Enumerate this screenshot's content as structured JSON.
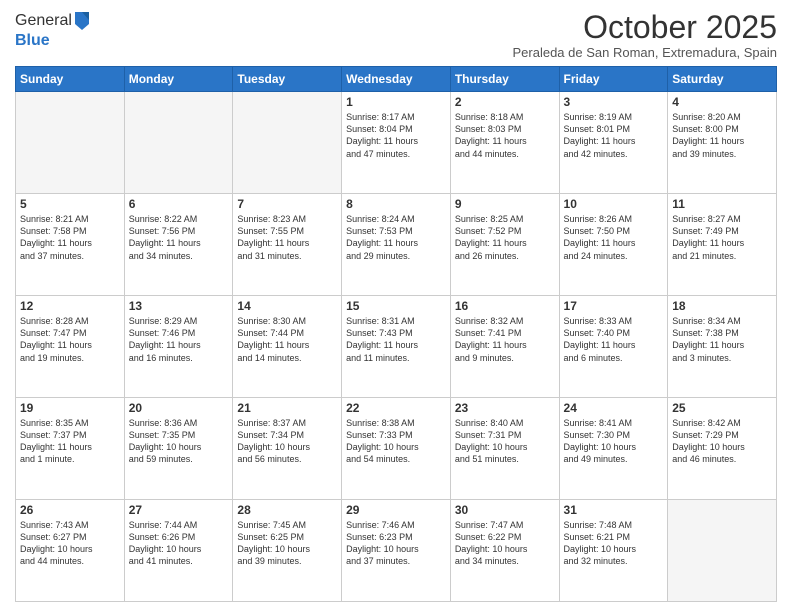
{
  "logo": {
    "general": "General",
    "blue": "Blue"
  },
  "header": {
    "month": "October 2025",
    "location": "Peraleda de San Roman, Extremadura, Spain"
  },
  "days": [
    "Sunday",
    "Monday",
    "Tuesday",
    "Wednesday",
    "Thursday",
    "Friday",
    "Saturday"
  ],
  "weeks": [
    [
      {
        "day": "",
        "content": ""
      },
      {
        "day": "",
        "content": ""
      },
      {
        "day": "",
        "content": ""
      },
      {
        "day": "1",
        "content": "Sunrise: 8:17 AM\nSunset: 8:04 PM\nDaylight: 11 hours\nand 47 minutes."
      },
      {
        "day": "2",
        "content": "Sunrise: 8:18 AM\nSunset: 8:03 PM\nDaylight: 11 hours\nand 44 minutes."
      },
      {
        "day": "3",
        "content": "Sunrise: 8:19 AM\nSunset: 8:01 PM\nDaylight: 11 hours\nand 42 minutes."
      },
      {
        "day": "4",
        "content": "Sunrise: 8:20 AM\nSunset: 8:00 PM\nDaylight: 11 hours\nand 39 minutes."
      }
    ],
    [
      {
        "day": "5",
        "content": "Sunrise: 8:21 AM\nSunset: 7:58 PM\nDaylight: 11 hours\nand 37 minutes."
      },
      {
        "day": "6",
        "content": "Sunrise: 8:22 AM\nSunset: 7:56 PM\nDaylight: 11 hours\nand 34 minutes."
      },
      {
        "day": "7",
        "content": "Sunrise: 8:23 AM\nSunset: 7:55 PM\nDaylight: 11 hours\nand 31 minutes."
      },
      {
        "day": "8",
        "content": "Sunrise: 8:24 AM\nSunset: 7:53 PM\nDaylight: 11 hours\nand 29 minutes."
      },
      {
        "day": "9",
        "content": "Sunrise: 8:25 AM\nSunset: 7:52 PM\nDaylight: 11 hours\nand 26 minutes."
      },
      {
        "day": "10",
        "content": "Sunrise: 8:26 AM\nSunset: 7:50 PM\nDaylight: 11 hours\nand 24 minutes."
      },
      {
        "day": "11",
        "content": "Sunrise: 8:27 AM\nSunset: 7:49 PM\nDaylight: 11 hours\nand 21 minutes."
      }
    ],
    [
      {
        "day": "12",
        "content": "Sunrise: 8:28 AM\nSunset: 7:47 PM\nDaylight: 11 hours\nand 19 minutes."
      },
      {
        "day": "13",
        "content": "Sunrise: 8:29 AM\nSunset: 7:46 PM\nDaylight: 11 hours\nand 16 minutes."
      },
      {
        "day": "14",
        "content": "Sunrise: 8:30 AM\nSunset: 7:44 PM\nDaylight: 11 hours\nand 14 minutes."
      },
      {
        "day": "15",
        "content": "Sunrise: 8:31 AM\nSunset: 7:43 PM\nDaylight: 11 hours\nand 11 minutes."
      },
      {
        "day": "16",
        "content": "Sunrise: 8:32 AM\nSunset: 7:41 PM\nDaylight: 11 hours\nand 9 minutes."
      },
      {
        "day": "17",
        "content": "Sunrise: 8:33 AM\nSunset: 7:40 PM\nDaylight: 11 hours\nand 6 minutes."
      },
      {
        "day": "18",
        "content": "Sunrise: 8:34 AM\nSunset: 7:38 PM\nDaylight: 11 hours\nand 3 minutes."
      }
    ],
    [
      {
        "day": "19",
        "content": "Sunrise: 8:35 AM\nSunset: 7:37 PM\nDaylight: 11 hours\nand 1 minute."
      },
      {
        "day": "20",
        "content": "Sunrise: 8:36 AM\nSunset: 7:35 PM\nDaylight: 10 hours\nand 59 minutes."
      },
      {
        "day": "21",
        "content": "Sunrise: 8:37 AM\nSunset: 7:34 PM\nDaylight: 10 hours\nand 56 minutes."
      },
      {
        "day": "22",
        "content": "Sunrise: 8:38 AM\nSunset: 7:33 PM\nDaylight: 10 hours\nand 54 minutes."
      },
      {
        "day": "23",
        "content": "Sunrise: 8:40 AM\nSunset: 7:31 PM\nDaylight: 10 hours\nand 51 minutes."
      },
      {
        "day": "24",
        "content": "Sunrise: 8:41 AM\nSunset: 7:30 PM\nDaylight: 10 hours\nand 49 minutes."
      },
      {
        "day": "25",
        "content": "Sunrise: 8:42 AM\nSunset: 7:29 PM\nDaylight: 10 hours\nand 46 minutes."
      }
    ],
    [
      {
        "day": "26",
        "content": "Sunrise: 7:43 AM\nSunset: 6:27 PM\nDaylight: 10 hours\nand 44 minutes."
      },
      {
        "day": "27",
        "content": "Sunrise: 7:44 AM\nSunset: 6:26 PM\nDaylight: 10 hours\nand 41 minutes."
      },
      {
        "day": "28",
        "content": "Sunrise: 7:45 AM\nSunset: 6:25 PM\nDaylight: 10 hours\nand 39 minutes."
      },
      {
        "day": "29",
        "content": "Sunrise: 7:46 AM\nSunset: 6:23 PM\nDaylight: 10 hours\nand 37 minutes."
      },
      {
        "day": "30",
        "content": "Sunrise: 7:47 AM\nSunset: 6:22 PM\nDaylight: 10 hours\nand 34 minutes."
      },
      {
        "day": "31",
        "content": "Sunrise: 7:48 AM\nSunset: 6:21 PM\nDaylight: 10 hours\nand 32 minutes."
      },
      {
        "day": "",
        "content": ""
      }
    ]
  ]
}
